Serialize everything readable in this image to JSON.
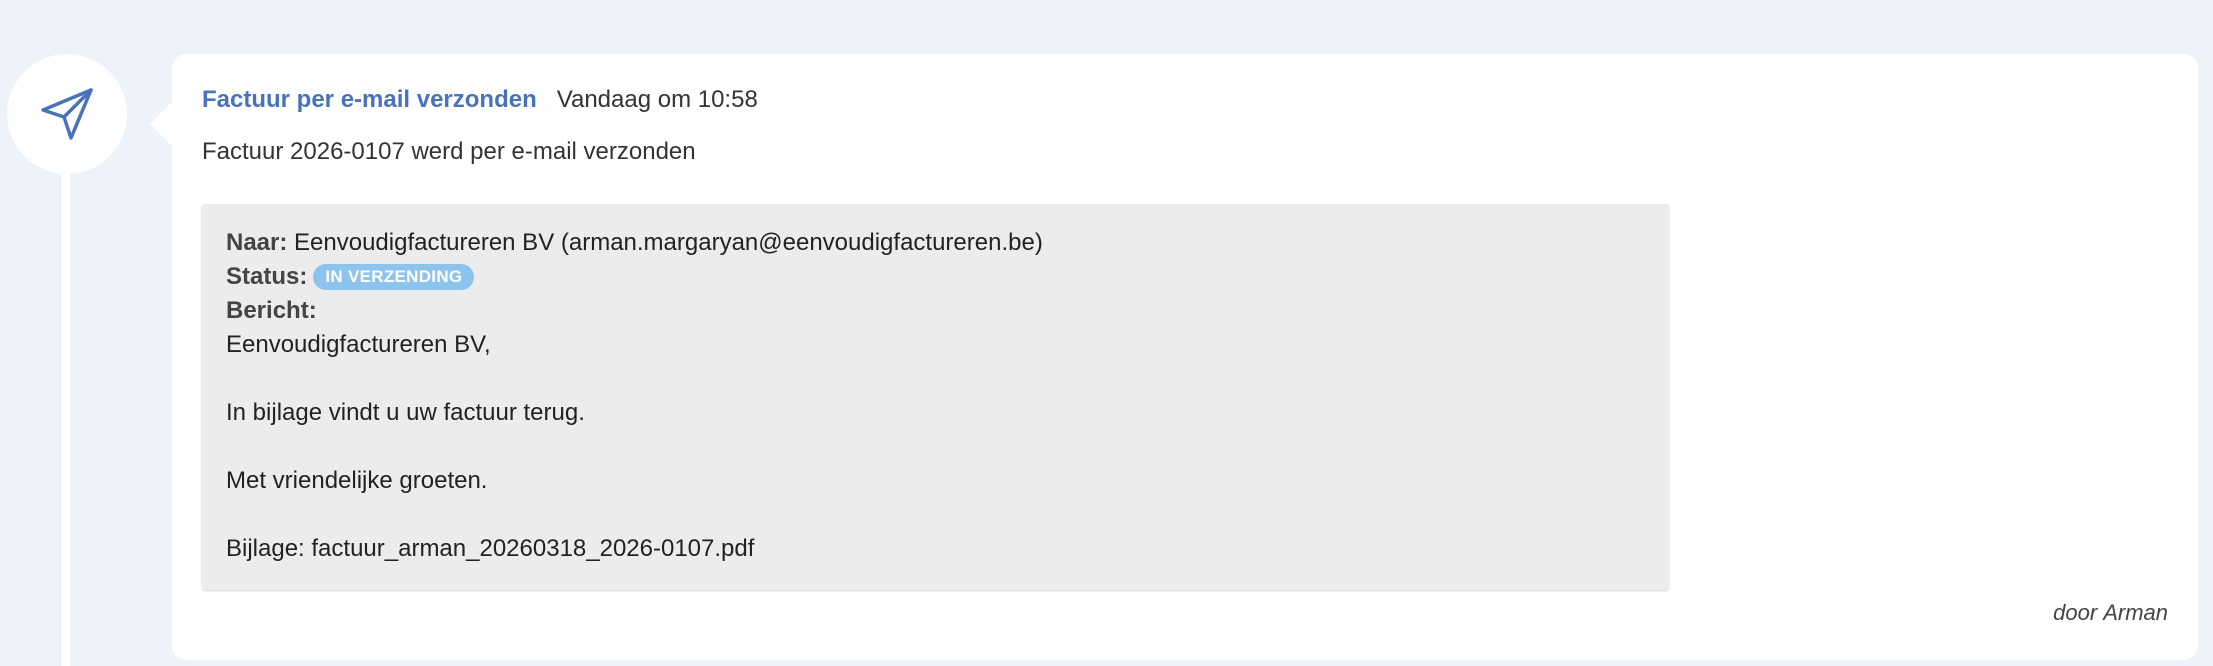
{
  "timeline": {
    "icon": "paper-plane-icon",
    "icon_color": "#4a72b8"
  },
  "event": {
    "title": "Factuur per e-mail verzonden",
    "time": "Vandaag om 10:58",
    "description": "Factuur 2026-0107 werd per e-mail verzonden",
    "title_color": "#4a72b8"
  },
  "email": {
    "to_label": "Naar:",
    "to_value": "Eenvoudigfactureren BV (arman.margaryan@eenvoudigfactureren.be)",
    "status_label": "Status:",
    "status_badge": "IN VERZENDING",
    "status_color": "#8cc4ee",
    "message_label": "Bericht:",
    "message_lines": [
      "Eenvoudigfactureren BV,",
      "",
      "In bijlage vindt u uw factuur terug.",
      "",
      "Met vriendelijke groeten.",
      "",
      "Bijlage: factuur_arman_20260318_2026-0107.pdf"
    ]
  },
  "author": {
    "prefix": "door",
    "name": "Arman"
  }
}
